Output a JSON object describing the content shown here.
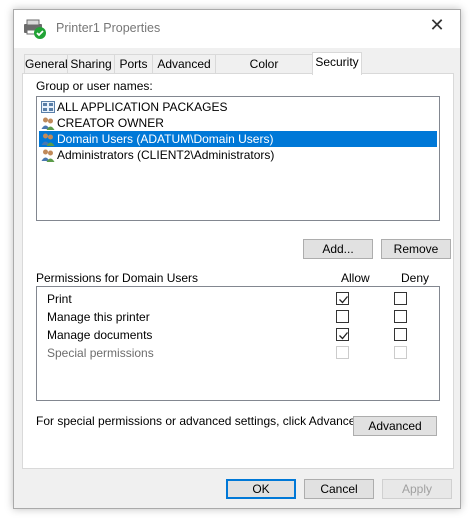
{
  "window": {
    "title": "Printer1 Properties",
    "close_glyph": "✕"
  },
  "tabs": [
    {
      "label": "General"
    },
    {
      "label": "Sharing"
    },
    {
      "label": "Ports"
    },
    {
      "label": "Advanced"
    },
    {
      "label": "Color Management"
    },
    {
      "label": "Security",
      "active": true
    }
  ],
  "groups": {
    "label": "Group or user names:",
    "items": [
      {
        "name": "ALL APPLICATION PACKAGES",
        "icon": "packages-icon"
      },
      {
        "name": "CREATOR OWNER",
        "icon": "users-icon"
      },
      {
        "name": "Domain Users (ADATUM\\Domain Users)",
        "icon": "users-icon",
        "selected": true
      },
      {
        "name": "Administrators (CLIENT2\\Administrators)",
        "icon": "users-icon"
      }
    ],
    "add_label": "Add...",
    "remove_label": "Remove"
  },
  "permissions": {
    "label": "Permissions for Domain Users",
    "allow_header": "Allow",
    "deny_header": "Deny",
    "rows": [
      {
        "name": "Print",
        "allow": true,
        "deny": false,
        "disabled": false
      },
      {
        "name": "Manage this printer",
        "allow": false,
        "deny": false,
        "disabled": false
      },
      {
        "name": "Manage documents",
        "allow": true,
        "deny": false,
        "disabled": false
      },
      {
        "name": "Special permissions",
        "allow": false,
        "deny": false,
        "disabled": true
      }
    ]
  },
  "advanced": {
    "text": "For special permissions or advanced settings, click Advanced.",
    "button_label": "Advanced"
  },
  "footer": {
    "ok_label": "OK",
    "cancel_label": "Cancel",
    "apply_label": "Apply"
  },
  "colors": {
    "selection": "#0078d7",
    "panel": "#ffffff",
    "chrome": "#f0f0f0"
  }
}
